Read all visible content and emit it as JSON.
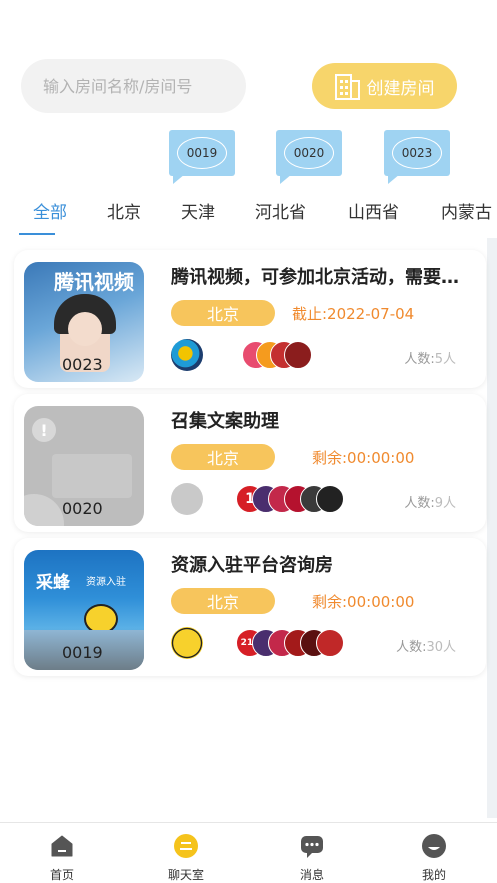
{
  "search": {
    "placeholder": "输入房间名称/房间号"
  },
  "create_button": {
    "label": "创建房间"
  },
  "bubbles": [
    {
      "label": "0019"
    },
    {
      "label": "0020"
    },
    {
      "label": "0023"
    }
  ],
  "tabs": [
    "全部",
    "北京",
    "天津",
    "河北省",
    "山西省",
    "内蒙古"
  ],
  "rooms": [
    {
      "title": "腾讯视频，可参加北京活动，需要…",
      "city": "北京",
      "status": "截止:2022-07-04",
      "number": "0023",
      "count_label": "人数:",
      "count": "5人"
    },
    {
      "title": "召集文案助理",
      "city": "北京",
      "status": "剩余:00:00:00",
      "number": "0020",
      "count_label": "人数:",
      "count": "9人"
    },
    {
      "title": "资源入驻平台咨询房",
      "city": "北京",
      "status": "剩余:00:00:00",
      "number": "0019",
      "count_label": "人数:",
      "count": "30人"
    }
  ],
  "thumb_text": {
    "room1": "腾讯视频",
    "room3_brand": "采蜂",
    "room3_sub": "资源入驻"
  },
  "member_badges": {
    "b1": "1",
    "b2": "210"
  },
  "bottom_nav": [
    "首页",
    "聊天室",
    "消息",
    "我的"
  ],
  "colors": {
    "accent_blue": "#3a8fd9",
    "tag_yellow": "#f7c55c",
    "status_orange": "#f08a2e",
    "create_yellow": "#f7d56b"
  }
}
